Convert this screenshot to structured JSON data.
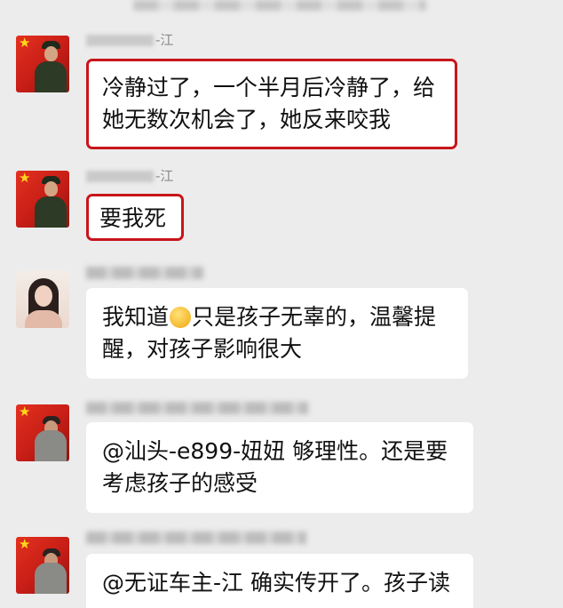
{
  "messages": [
    {
      "sender": "-江",
      "lines": [
        "冷静过了，一个半月后冷静了，给",
        "她无数次机会了，她反来咬我"
      ],
      "highlighted": true
    },
    {
      "sender": "-江",
      "lines": [
        "要我死"
      ],
      "highlighted": true
    },
    {
      "sender": "",
      "line1_before": "我知道",
      "line1_after": "只是孩子无辜的，温馨提",
      "line2": "醒，对孩子影响很大",
      "emoji": "grinning-emoji"
    },
    {
      "sender": "",
      "lines": [
        "@汕头-e899-妞妞 够理性。还是要",
        "考虑孩子的感受"
      ]
    },
    {
      "sender": "",
      "lines": [
        "@无证车主-江 确实传开了。孩子读"
      ]
    }
  ],
  "colors": {
    "background": "#ececec",
    "bubble": "#ffffff",
    "highlight_border": "#c8151b",
    "sender_name": "#8a8a8a",
    "text": "#111111"
  }
}
